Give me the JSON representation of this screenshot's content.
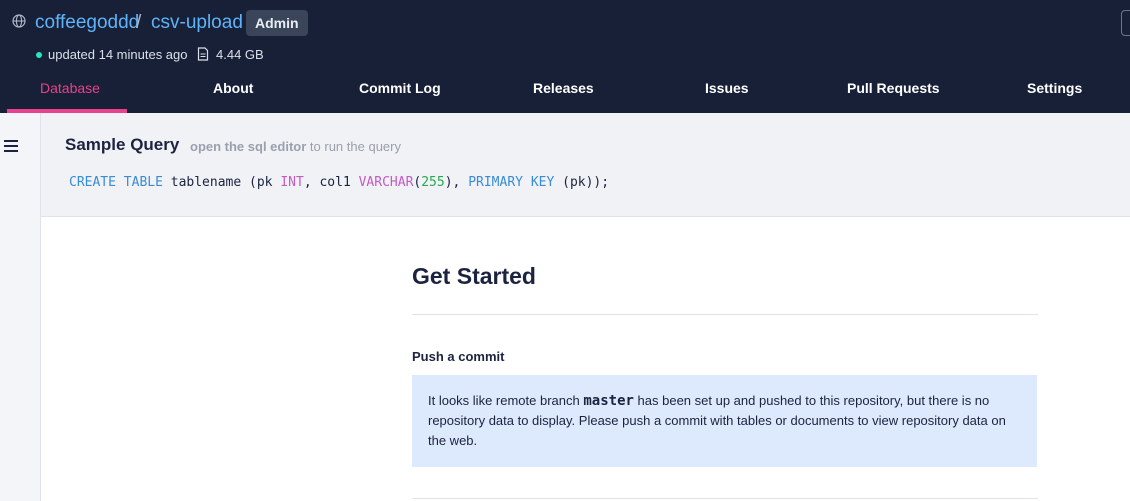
{
  "header": {
    "owner": "coffeegoddd",
    "separator": "/",
    "repo": "csv-upload",
    "badge": "Admin",
    "updated": "updated 14 minutes ago",
    "size": "4.44 GB"
  },
  "tabs": [
    {
      "label": "Database",
      "active": true
    },
    {
      "label": "About"
    },
    {
      "label": "Commit Log"
    },
    {
      "label": "Releases"
    },
    {
      "label": "Issues"
    },
    {
      "label": "Pull Requests"
    },
    {
      "label": "Settings"
    }
  ],
  "sample_query": {
    "title": "Sample Query",
    "hint_link": "open the sql editor",
    "hint_rest": "to run the query",
    "code": {
      "kw1": "CREATE TABLE",
      "t1": " tablename (pk ",
      "ty1": "INT",
      "t2": ", col1 ",
      "ty2": "VARCHAR",
      "t3": "(",
      "num": "255",
      "t4": "), ",
      "kw2": "PRIMARY KEY",
      "t5": " (pk));"
    }
  },
  "main": {
    "title": "Get Started",
    "push_title": "Push a commit",
    "info_pre": "It looks like remote branch ",
    "info_branch": "master",
    "info_post": " has been set up and pushed to this repository, but there is no repository data to display. Please push a commit with tables or documents to view repository data on the web."
  },
  "colors": {
    "accent": "#e8418d",
    "header_bg": "#172036",
    "link": "#5fb3f9",
    "info_bg": "#dde9fd"
  },
  "icons": {
    "globe": "globe-icon",
    "file": "file-icon",
    "menu": "menu-icon"
  }
}
